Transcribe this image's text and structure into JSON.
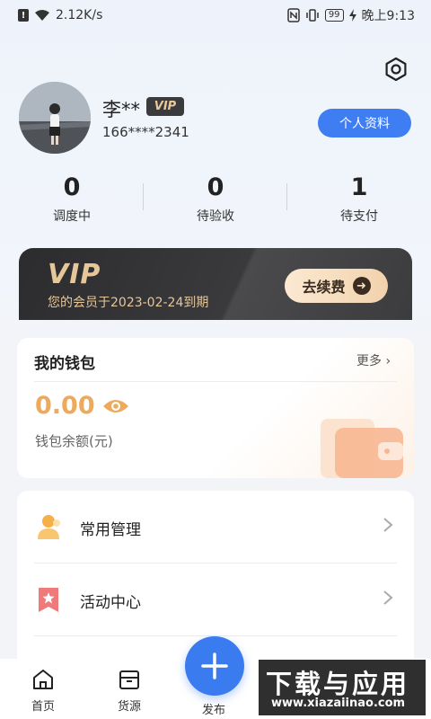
{
  "status_bar": {
    "speed": "2.12K/s",
    "battery": "99",
    "time": "晚上9:13"
  },
  "profile": {
    "name": "李**",
    "vip_badge": "VIP",
    "phone": "166****2341",
    "profile_button": "个人资料"
  },
  "stats": [
    {
      "value": "0",
      "label": "调度中"
    },
    {
      "value": "0",
      "label": "待验收"
    },
    {
      "value": "1",
      "label": "待支付"
    }
  ],
  "vip_card": {
    "logo": "VIP",
    "expire": "您的会员于2023-02-24到期",
    "renew": "去续费"
  },
  "wallet": {
    "title": "我的钱包",
    "more": "更多 ›",
    "amount": "0.00",
    "label": "钱包余额(元)"
  },
  "menu": [
    {
      "label": "常用管理",
      "icon": "person-manage-icon"
    },
    {
      "label": "活动中心",
      "icon": "star-bookmark-icon"
    }
  ],
  "tab_bar": {
    "home": "首页",
    "cargo": "货源",
    "publish": "发布"
  },
  "watermark": {
    "main": "下载与应用",
    "sub": "www.xiazaiinao.com"
  },
  "colors": {
    "accent": "#3f7ef2",
    "gold": "#e6c79a",
    "amount": "#eda95c"
  }
}
